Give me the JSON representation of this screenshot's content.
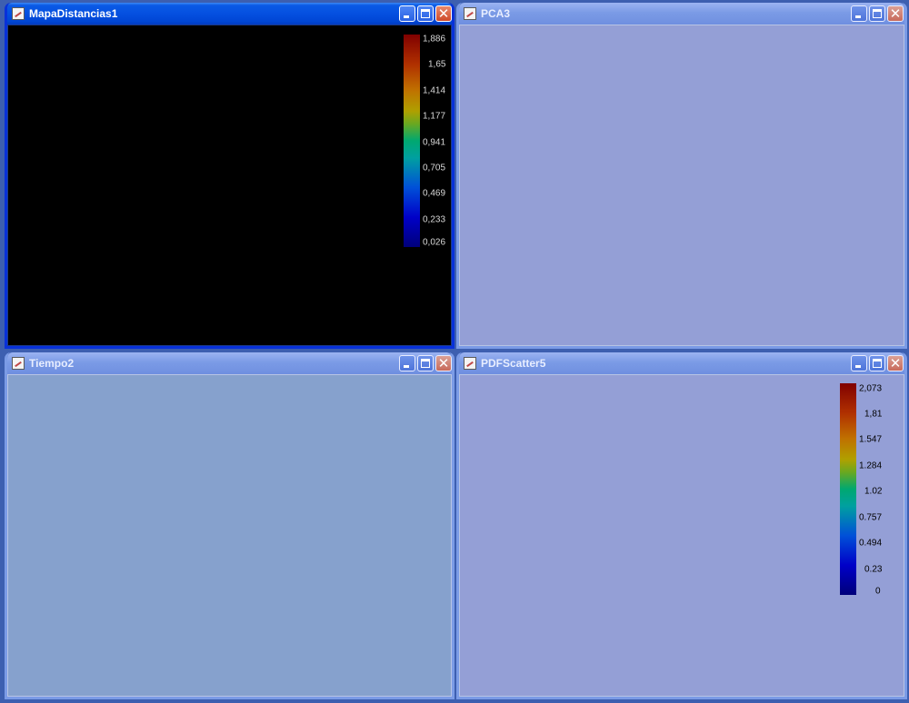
{
  "windows": {
    "mapa": {
      "title": "MapaDistancias1",
      "scale_labels": [
        "1,886",
        "1,65",
        "1,414",
        "1,177",
        "0,941",
        "0,705",
        "0,469",
        "0,233",
        "0,026"
      ]
    },
    "pca": {
      "title": "PCA3"
    },
    "tiempo": {
      "title": "Tiempo2"
    },
    "pdf": {
      "title": "PDFScatter5",
      "scale_labels": [
        "2,073",
        "1,81",
        "1.547",
        "1.284",
        "1.02",
        "0.757",
        "0.494",
        "0.23",
        "0"
      ]
    }
  },
  "colors": {
    "mapa_background": "#000000",
    "pca_background": "#949fd6",
    "tiempo_background": "#86a1cd",
    "pdf_background": "#949fd6",
    "active_titlebar": "#0550e0",
    "inactive_titlebar": "#7b9be6"
  },
  "icons": {
    "window_icon": "chart-window-icon",
    "minimize": "minimize-icon",
    "maximize": "maximize-icon",
    "close": "close-icon"
  }
}
